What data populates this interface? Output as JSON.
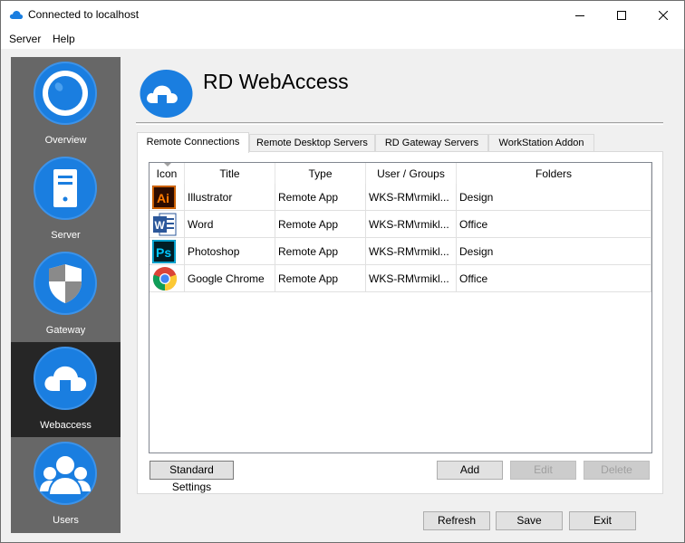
{
  "window": {
    "title": "Connected to localhost"
  },
  "menu": {
    "items": [
      "Server",
      "Help"
    ]
  },
  "sidebar": {
    "items": [
      {
        "label": "Overview",
        "icon": "eye-icon"
      },
      {
        "label": "Server",
        "icon": "server-icon"
      },
      {
        "label": "Gateway",
        "icon": "shield-icon"
      },
      {
        "label": "Webaccess",
        "icon": "cloud-icon",
        "active": true
      },
      {
        "label": "Users",
        "icon": "users-icon"
      }
    ]
  },
  "header": {
    "title": "RD WebAccess"
  },
  "tabs": [
    {
      "label": "Remote Connections",
      "active": true
    },
    {
      "label": "Remote Desktop Servers"
    },
    {
      "label": "RD Gateway Servers"
    },
    {
      "label": "WorkStation Addon"
    }
  ],
  "table": {
    "columns": [
      "Icon",
      "Title",
      "Type",
      "User / Groups",
      "Folders"
    ],
    "rows": [
      {
        "icon": "illustrator-icon",
        "title": "Illustrator",
        "type": "Remote App",
        "users": "WKS-RM\\rmikl...",
        "folders": "Design"
      },
      {
        "icon": "word-icon",
        "title": "Word",
        "type": "Remote App",
        "users": "WKS-RM\\rmikl...",
        "folders": "Office"
      },
      {
        "icon": "photoshop-icon",
        "title": "Photoshop",
        "type": "Remote App",
        "users": "WKS-RM\\rmikl...",
        "folders": "Design"
      },
      {
        "icon": "chrome-icon",
        "title": "Google Chrome",
        "type": "Remote App",
        "users": "WKS-RM\\rmikl...",
        "folders": "Office"
      }
    ]
  },
  "buttons": {
    "standard_settings": "Standard Settings",
    "add": "Add",
    "edit": "Edit",
    "delete": "Delete",
    "refresh": "Refresh",
    "save": "Save",
    "exit": "Exit"
  },
  "colors": {
    "accent": "#1a7ee0",
    "sidebar_bg": "#676767",
    "sidebar_active": "#262626"
  }
}
